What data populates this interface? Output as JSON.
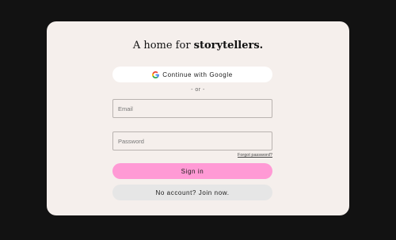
{
  "login": {
    "headline_prefix": "A home for ",
    "headline_emphasis": "storytellers.",
    "google_button_label": "Continue with Google",
    "divider_text": "- or -",
    "email_placeholder": "Email",
    "password_placeholder": "Password",
    "forgot_password_label": "Forgot password?",
    "sign_in_label": "Sign in",
    "join_label": "No account? Join now."
  },
  "icons": {
    "google": "google-g-icon"
  },
  "colors": {
    "page_background": "#121212",
    "card_background": "#f5efec",
    "sign_in_button": "#ff9ad5",
    "join_button": "#e6e6e6",
    "google_button": "#ffffff"
  }
}
